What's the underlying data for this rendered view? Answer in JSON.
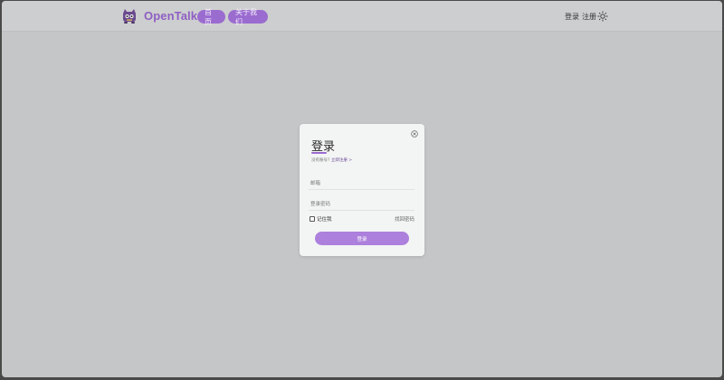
{
  "header": {
    "brand": "OpenTalk",
    "nav": [
      {
        "label": "首页"
      },
      {
        "label": "关于我们"
      }
    ],
    "login_link": "登录",
    "register_link": "注册",
    "theme_icon": "sun-icon",
    "logo_icon": "cat-mascot-icon"
  },
  "login_modal": {
    "title": "登录",
    "no_account_text": "没有账号?",
    "register_now_link": "立即注册 >",
    "email_placeholder": "邮箱",
    "password_placeholder": "登录密码",
    "remember_me_label": "记住我",
    "remember_me_checked": false,
    "forgot_password_link": "找回密码",
    "submit_label": "登录",
    "close_icon": "close-circle-icon"
  },
  "colors": {
    "accent": "#9b6cd0",
    "accent_button": "#ac80dc",
    "brand_text": "#8e5fc3",
    "overlay": "#c5c6c8",
    "modal_bg": "#f3f4f4"
  }
}
